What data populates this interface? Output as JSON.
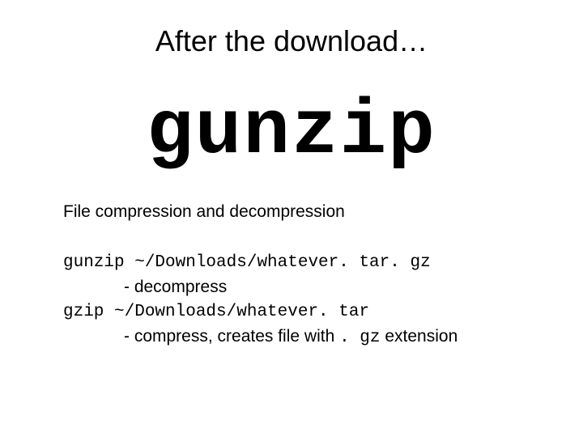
{
  "title": "After the download…",
  "hero": "gunzip",
  "subtitle": "File compression and decompression",
  "lines": {
    "cmd1": "gunzip ~/Downloads/whatever. tar. gz",
    "desc1": "- decompress",
    "cmd2": "gzip ~/Downloads/whatever. tar",
    "desc2_a": "- compress, creates file with",
    "desc2_ext": ". gz",
    "desc2_b": " extension"
  }
}
